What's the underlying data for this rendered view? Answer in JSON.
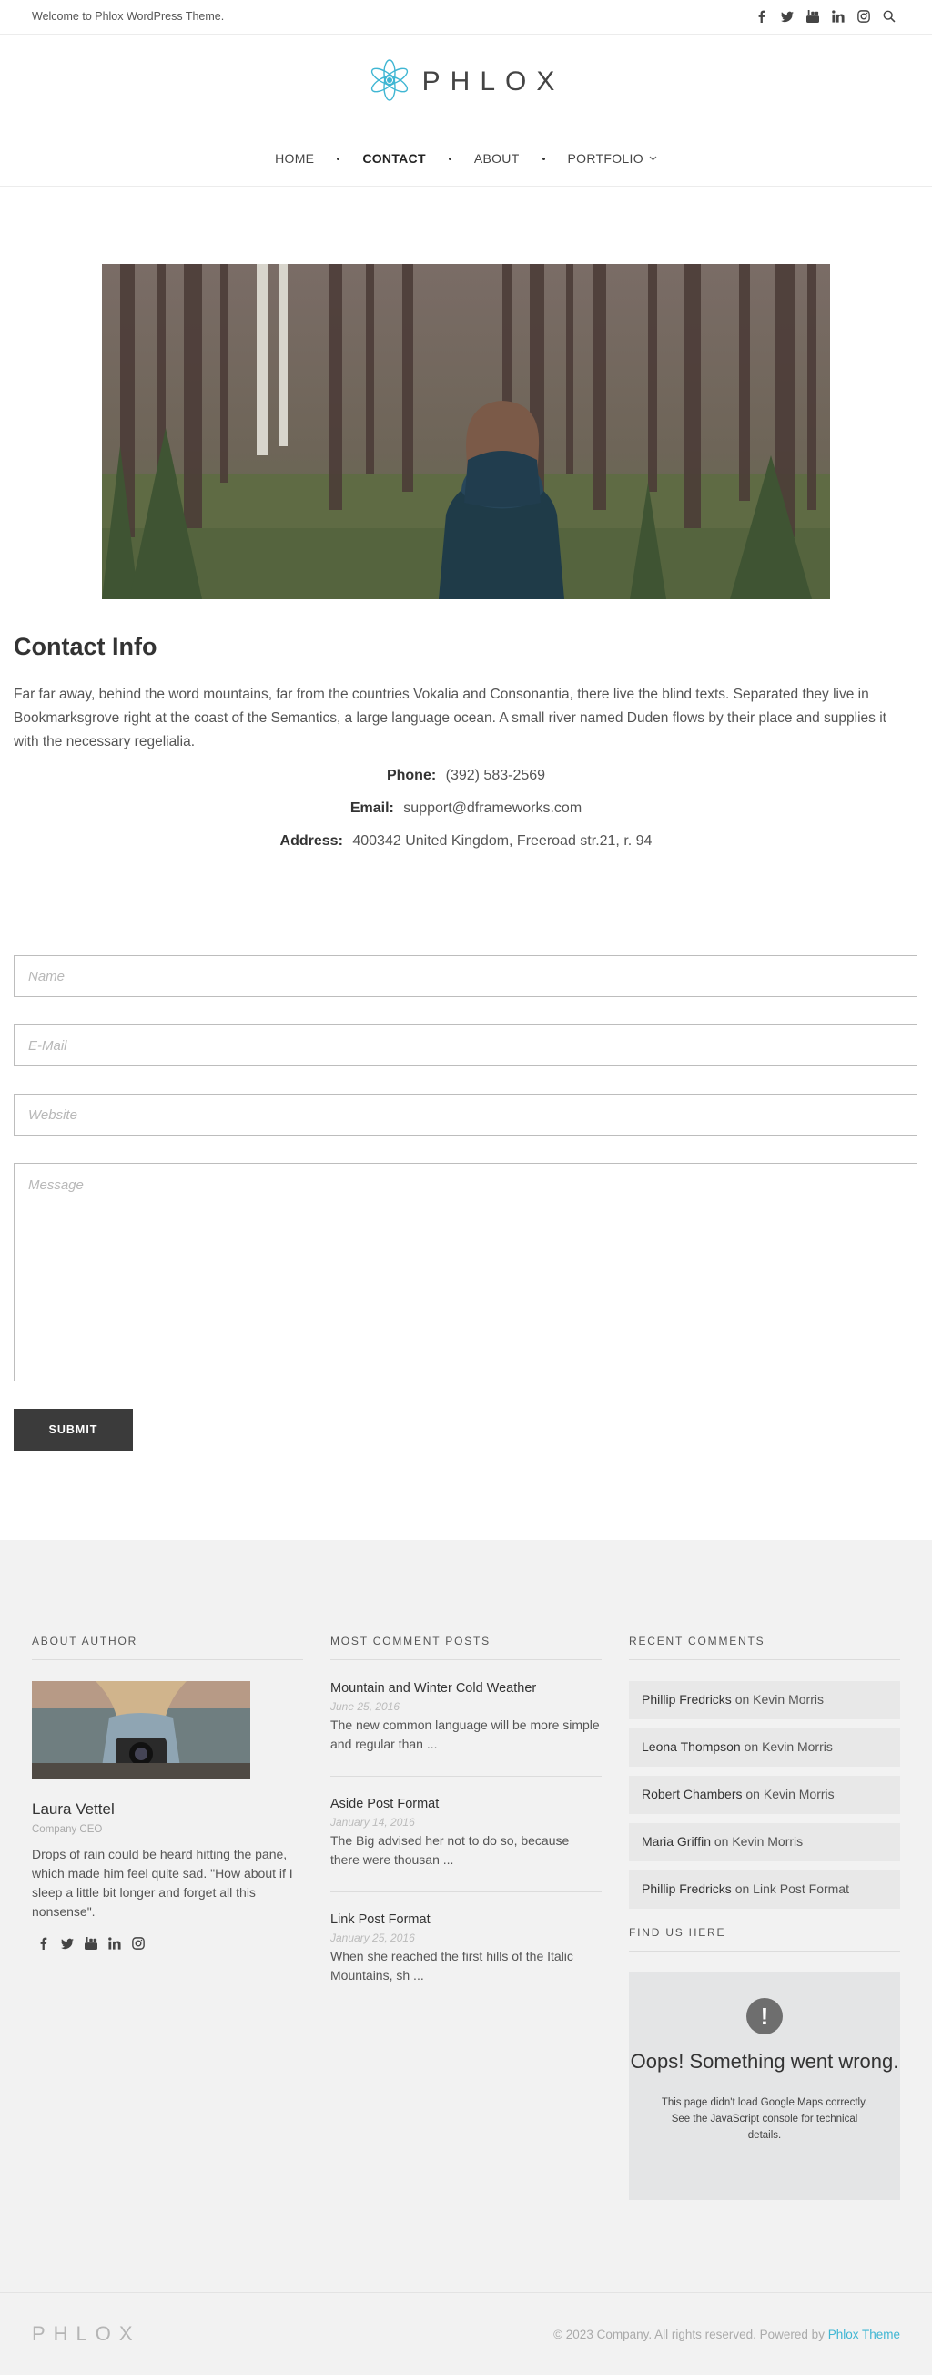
{
  "topbar": {
    "welcome": "Welcome to Phlox WordPress Theme.",
    "icons": [
      "facebook-icon",
      "twitter-icon",
      "youtube-icon",
      "linkedin-icon",
      "instagram-icon",
      "search-icon"
    ]
  },
  "header": {
    "logo_text": "PHLOX",
    "nav": [
      {
        "label": "HOME"
      },
      {
        "label": "CONTACT",
        "active": true
      },
      {
        "label": "ABOUT"
      },
      {
        "label": "PORTFOLIO",
        "has_dropdown": true
      }
    ]
  },
  "contact": {
    "title": "Contact Info",
    "text": "Far far away, behind the word mountains, far from the countries Vokalia and Consonantia, there live the blind texts. Separated they live in Bookmarksgrove right at the coast of the Semantics, a large language ocean. A small river named Duden flows by their place and supplies it with the necessary regelialia.",
    "phone_label": "Phone:",
    "phone": "(392) 583-2569",
    "email_label": "Email:",
    "email": "support@dframeworks.com",
    "address_label": "Address:",
    "address": "400342 United Kingdom, Freeroad str.21, r. 94"
  },
  "form": {
    "name_placeholder": "Name",
    "email_placeholder": "E-Mail",
    "website_placeholder": "Website",
    "message_placeholder": "Message",
    "submit": "SUBMIT"
  },
  "footer": {
    "about": {
      "title": "ABOUT AUTHOR",
      "name": "Laura Vettel",
      "role": "Company CEO",
      "bio": "Drops of rain could be heard hitting the pane, which made him feel quite sad. \"How about if I sleep a little bit longer and forget all this nonsense\"."
    },
    "posts": {
      "title": "MOST COMMENT POSTS",
      "items": [
        {
          "title": "Mountain and Winter Cold Weather",
          "date": "June 25, 2016",
          "excerpt": "The new common language will be more simple and regular than ..."
        },
        {
          "title": "Aside Post Format",
          "date": "January 14, 2016",
          "excerpt": "The Big advised her not to do so, because there were thousan ..."
        },
        {
          "title": "Link Post Format",
          "date": "January 25, 2016",
          "excerpt": "When she reached the first hills of the Italic Mountains, sh ..."
        }
      ]
    },
    "comments": {
      "title": "RECENT COMMENTS",
      "on": "on",
      "items": [
        {
          "author": "Phillip Fredricks",
          "post": "Kevin Morris"
        },
        {
          "author": "Leona Thompson",
          "post": "Kevin Morris"
        },
        {
          "author": "Robert Chambers",
          "post": "Kevin Morris"
        },
        {
          "author": "Maria Griffin",
          "post": "Kevin Morris"
        },
        {
          "author": "Phillip Fredricks",
          "post": "Link Post Format"
        }
      ]
    },
    "map": {
      "title": "FIND US HERE",
      "icon": "!",
      "error_title": "Oops! Something went wrong.",
      "error_body": "This page didn't load Google Maps correctly. See the JavaScript console for technical details."
    }
  },
  "bottom": {
    "logo_text": "PHLOX",
    "copyright": "© 2023 Company. All rights reserved. Powered by",
    "link": "Phlox Theme"
  },
  "colors": {
    "accent": "#3fb6d3",
    "submit_bg": "#3b3b3b",
    "footer_bg": "#f2f2f2"
  }
}
